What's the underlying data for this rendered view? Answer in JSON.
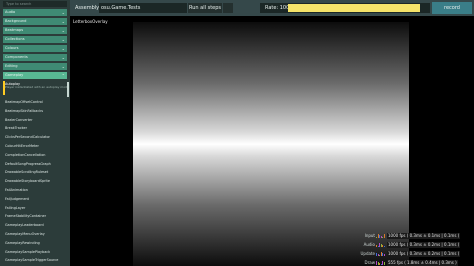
{
  "sidebar": {
    "search_placeholder": "Type to search",
    "categories": [
      {
        "label": "Audio"
      },
      {
        "label": "Background"
      },
      {
        "label": "Beatmaps"
      },
      {
        "label": "Collections"
      },
      {
        "label": "Colours"
      },
      {
        "label": "Components"
      },
      {
        "label": "Editing"
      },
      {
        "label": "Gameplay",
        "expanded": true
      }
    ],
    "selected_test": {
      "label": "Autoplay",
      "description": "Player instantiated with an autoplay mod."
    },
    "tests": [
      "BeatmapOffsetControl",
      "BeatmapSkinFallbacks",
      "BezierConverter",
      "BreakTracker",
      "ClicksPerSecondCalculator",
      "ColourHitErrorMeter",
      "CompletionCancellation",
      "DefaultSongProgressGraph",
      "DrawableScrollingRuleset",
      "DrawableStoryboardSprite",
      "FailAnimation",
      "FailJudgement",
      "FailingLayer",
      "FrameStabilityContainer",
      "GameplayLeaderboard",
      "GameplayMenuOverlay",
      "GameplayRewinding",
      "GameplaySamplePlayback",
      "GameplaySampleTriggerSource"
    ]
  },
  "toolbar": {
    "assembly_label": "Assembly",
    "assembly_value": "osu.Game.Tests",
    "run_all_label": "Run all steps",
    "rate_label": "Rate: 100%",
    "rate_fraction": 0.94,
    "record_label": "record"
  },
  "canvas": {
    "title": "LetterboxOverlay"
  },
  "fps": [
    {
      "name": "Input",
      "value": "1000 fps ( 0.3ms ± 0.1ms | 0.1ms )"
    },
    {
      "name": "Audio",
      "value": "1000 fps ( 0.3ms ± 0.2ms | 0.1ms )"
    },
    {
      "name": "Update",
      "value": "1000 fps ( 0.3ms ± 0.2ms | 0.1ms )"
    },
    {
      "name": "Draw",
      "value": "555 fps ( 1.8ms ± 0.4ms | 0.3ms )"
    }
  ],
  "colors": {
    "sidebar_bg": "#2c3c3a",
    "category_bg": "#3f8a74",
    "category_open_bg": "#58b793",
    "selection_accent": "#ffcc22",
    "rate_fill": "#f5e46a",
    "record_button": "#3a7e88"
  }
}
